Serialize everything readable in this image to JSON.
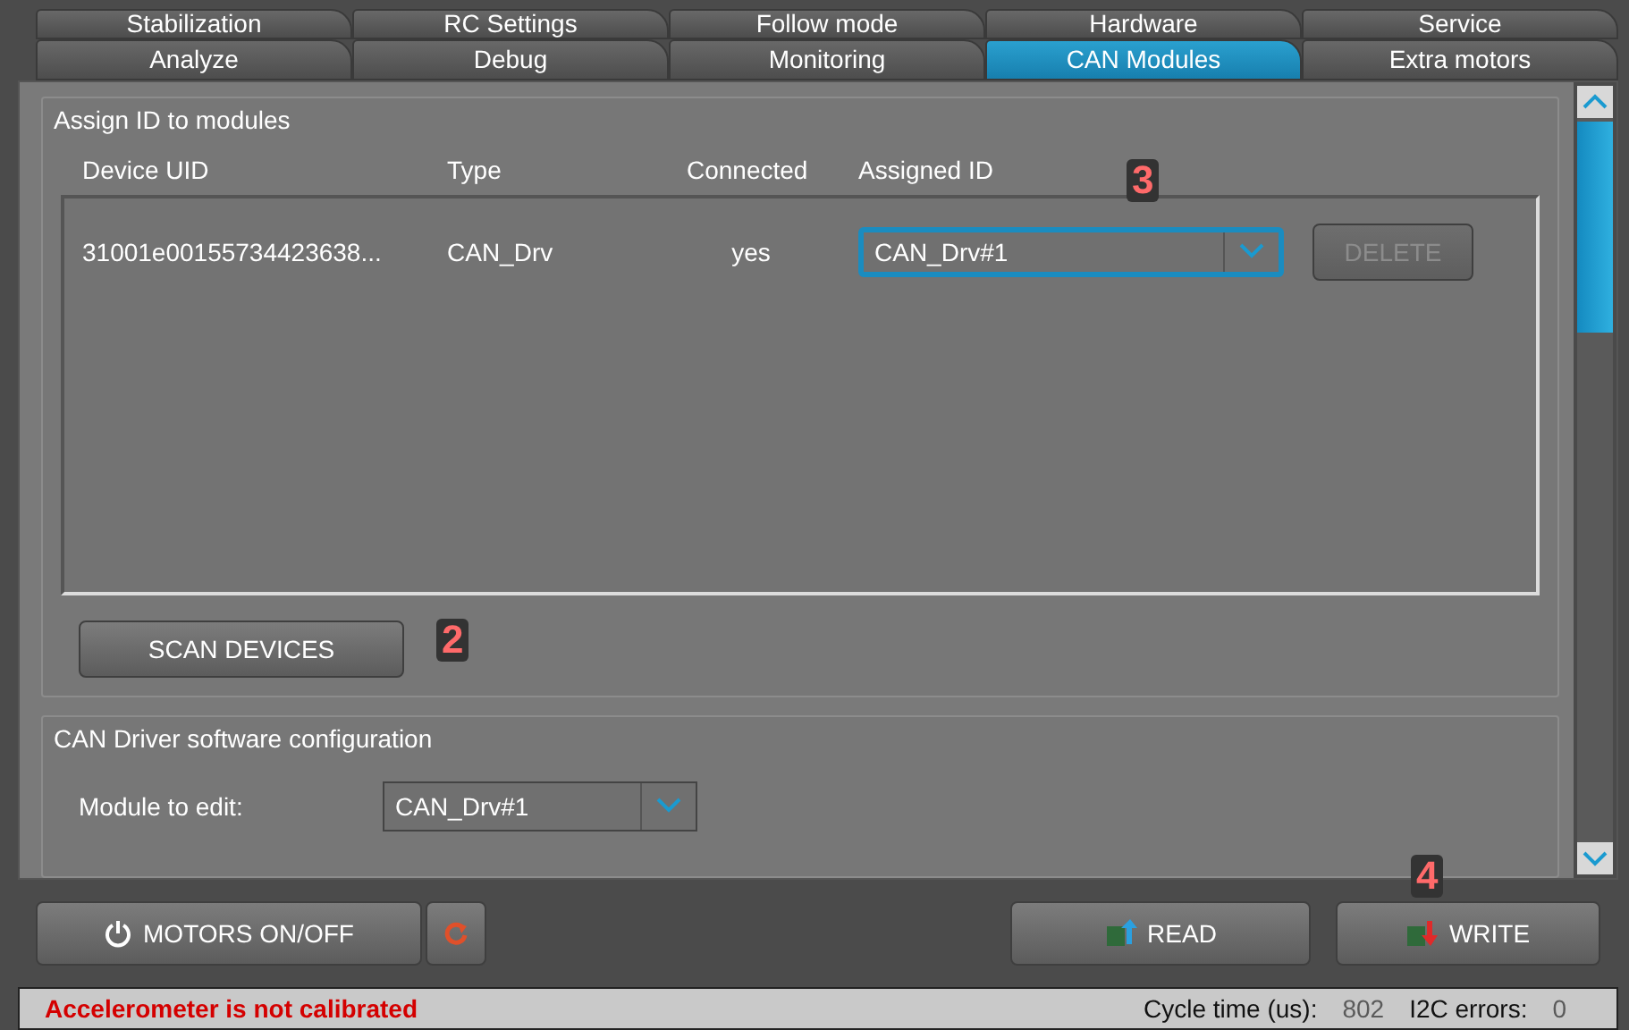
{
  "tabs_back": [
    {
      "label": "Stabilization",
      "selected": false
    },
    {
      "label": "RC Settings",
      "selected": false
    },
    {
      "label": "Follow mode",
      "selected": false
    },
    {
      "label": "Hardware",
      "selected": false
    },
    {
      "label": "Service",
      "selected": false
    }
  ],
  "tabs_front": [
    {
      "label": "Analyze",
      "selected": false
    },
    {
      "label": "Debug",
      "selected": false
    },
    {
      "label": "Monitoring",
      "selected": false
    },
    {
      "label": "CAN Modules",
      "selected": true
    },
    {
      "label": "Extra motors",
      "selected": false
    }
  ],
  "assign_group": {
    "title": "Assign ID to modules",
    "columns": [
      "Device UID",
      "Type",
      "Connected",
      "Assigned ID"
    ],
    "rows": [
      {
        "uid": "31001e00155734423638...",
        "type": "CAN_Drv",
        "connected": "yes",
        "assigned_id": "CAN_Drv#1",
        "delete_label": "DELETE",
        "delete_disabled": true
      }
    ],
    "scan_button": "SCAN DEVICES"
  },
  "config_group": {
    "title": "CAN Driver software configuration",
    "module_label": "Module to edit:",
    "module_value": "CAN_Drv#1"
  },
  "annotations": {
    "assigned_id": "3",
    "scan": "2",
    "write": "4"
  },
  "buttons": {
    "motors": "MOTORS ON/OFF",
    "read": "READ",
    "write": "WRITE"
  },
  "status_bar": {
    "message": "Accelerometer is not calibrated",
    "cycle_label": "Cycle time (us):",
    "cycle_value": "802",
    "i2c_label": "I2C errors:",
    "i2c_value": "0"
  }
}
